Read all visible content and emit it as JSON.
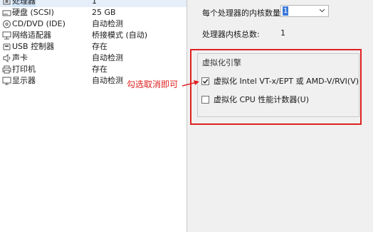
{
  "hardware_list": [
    {
      "icon": "processor-icon",
      "name": "处理器",
      "summary": "1",
      "selected": true
    },
    {
      "icon": "hard-disk-icon",
      "name": "硬盘 (SCSI)",
      "summary": "25 GB"
    },
    {
      "icon": "cd-dvd-icon",
      "name": "CD/DVD (IDE)",
      "summary": "自动检测"
    },
    {
      "icon": "network-adapter-icon",
      "name": "网络适配器",
      "summary": "桥接模式 (自动)"
    },
    {
      "icon": "usb-controller-icon",
      "name": "USB 控制器",
      "summary": "存在"
    },
    {
      "icon": "sound-card-icon",
      "name": "声卡",
      "summary": "自动检测"
    },
    {
      "icon": "printer-icon",
      "name": "打印机",
      "summary": "存在"
    },
    {
      "icon": "display-icon",
      "name": "显示器",
      "summary": "自动检测"
    }
  ],
  "processor": {
    "cores_per_processor_label": "每个处理器的内核数量(C):",
    "cores_per_processor_value": "1",
    "total_cores_label": "处理器内核总数:",
    "total_cores_value": "1"
  },
  "virtualization": {
    "group_title": "虚拟化引擎",
    "vtx_label": "虚拟化 Intel VT-x/EPT 或 AMD-V/RVI(V)",
    "vtx_checked": true,
    "perf_counter_label": "虚拟化 CPU 性能计数器(U)",
    "perf_counter_checked": false
  },
  "annotation": {
    "text": "勾选取消即可",
    "color": "#e02020"
  }
}
